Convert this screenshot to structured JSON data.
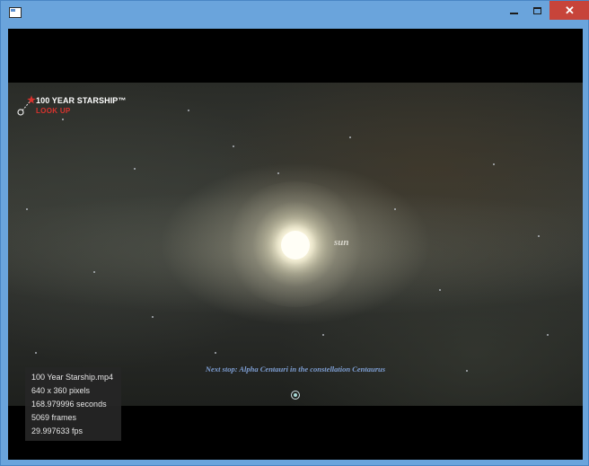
{
  "window": {
    "close_glyph": "✕"
  },
  "video": {
    "logo": {
      "title": "100 YEAR STARSHIP™",
      "subtitle": "LOOK UP"
    },
    "sun_label": "sun",
    "caption": "Next stop: Alpha Centauri in the constellation Centaurus"
  },
  "info_panel": {
    "filename": "100 Year Starship.mp4",
    "resolution": "640 x 360 pixels",
    "duration": "168.979996 seconds",
    "frames": "5069 frames",
    "fps": "29.997633 fps"
  },
  "colors": {
    "titlebar": "#6aa4dc",
    "close_button": "#c7443a",
    "logo_accent": "#d9332e",
    "caption": "#7e9fd4"
  }
}
